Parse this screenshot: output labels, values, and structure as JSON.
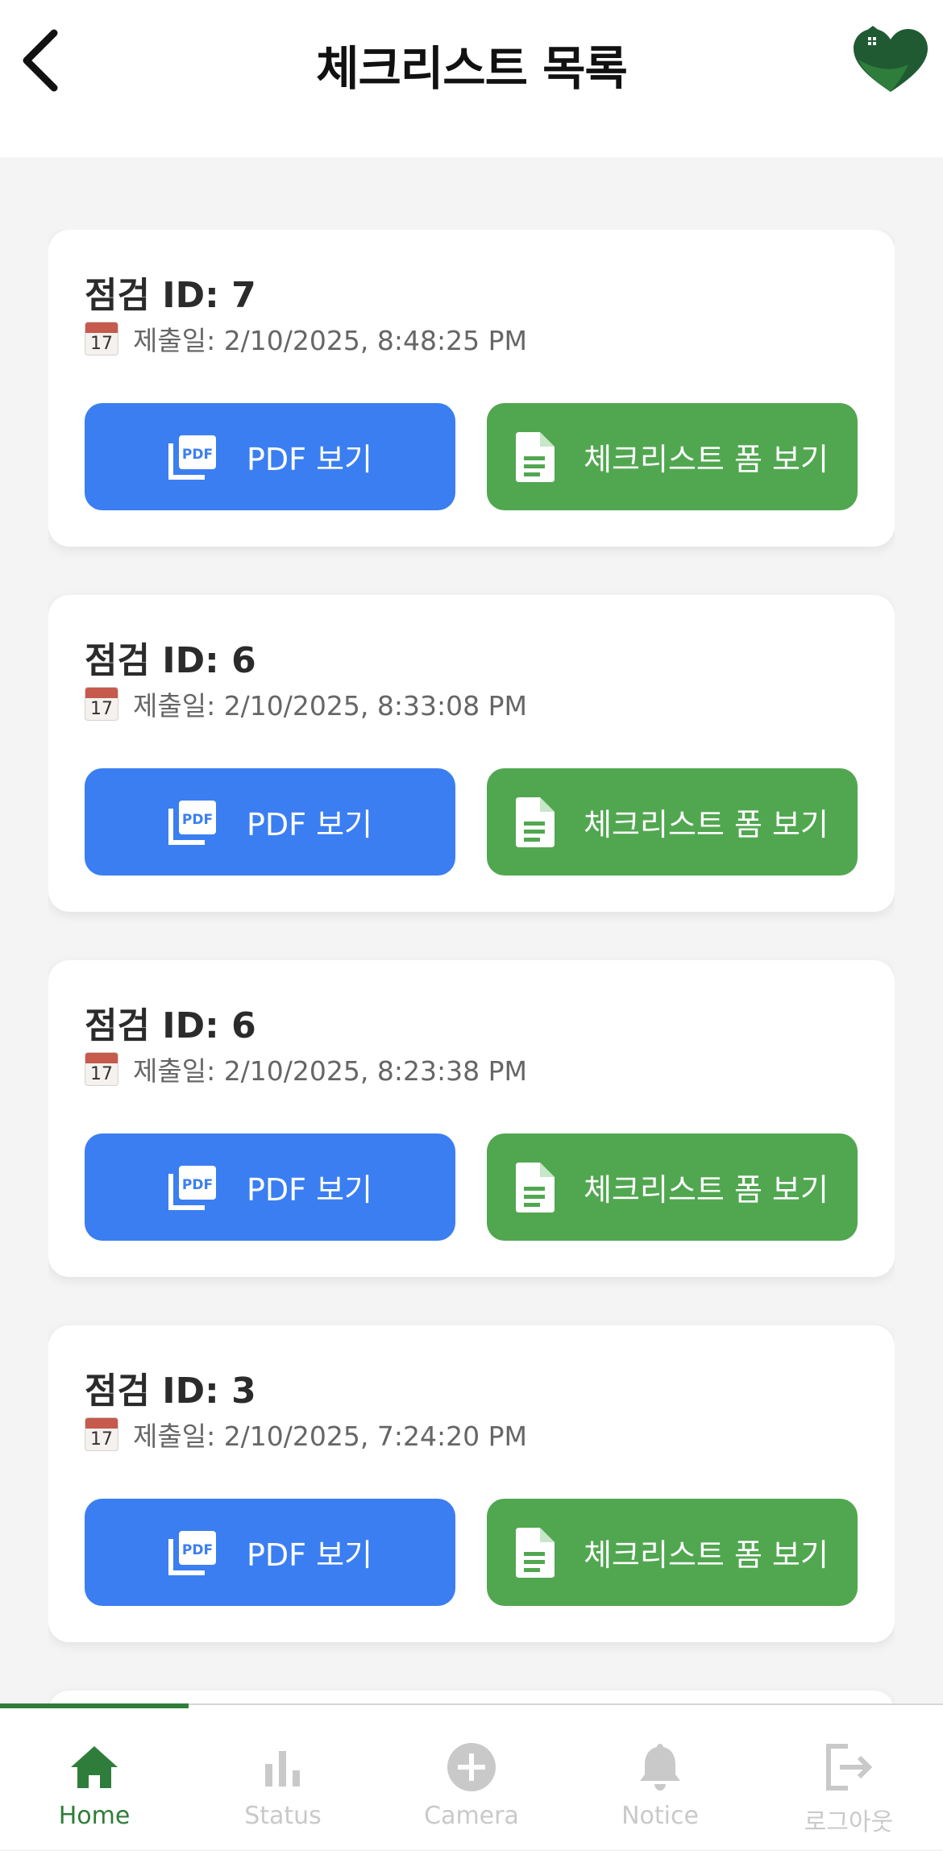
{
  "header": {
    "title": "체크리스트 목록",
    "back_icon": "chevron-left-icon",
    "logo_icon": "heart-house-logo"
  },
  "cards": [
    {
      "title": "점검 ID: 7",
      "date": "제출일: 2/10/2025, 8:48:25 PM",
      "calendar_day": "17",
      "pdf_label": "PDF 보기",
      "form_label": "체크리스트 폼 보기"
    },
    {
      "title": "점검 ID: 6",
      "date": "제출일: 2/10/2025, 8:33:08 PM",
      "calendar_day": "17",
      "pdf_label": "PDF 보기",
      "form_label": "체크리스트 폼 보기"
    },
    {
      "title": "점검 ID: 6",
      "date": "제출일: 2/10/2025, 8:23:38 PM",
      "calendar_day": "17",
      "pdf_label": "PDF 보기",
      "form_label": "체크리스트 폼 보기"
    },
    {
      "title": "점검 ID: 3",
      "date": "제출일: 2/10/2025, 7:24:20 PM",
      "calendar_day": "17",
      "pdf_label": "PDF 보기",
      "form_label": "체크리스트 폼 보기"
    }
  ],
  "tabs": [
    {
      "label": "Home",
      "icon": "home-icon",
      "active": true
    },
    {
      "label": "Status",
      "icon": "bar-chart-icon",
      "active": false
    },
    {
      "label": "Camera",
      "icon": "plus-circle-icon",
      "active": false
    },
    {
      "label": "Notice",
      "icon": "bell-icon",
      "active": false
    },
    {
      "label": "로그아웃",
      "icon": "logout-icon",
      "active": false
    }
  ],
  "colors": {
    "pdf_button": "#3b7ef1",
    "form_button": "#51a750",
    "active_tab": "#2f7d3a",
    "inactive_tab": "#c9c9c9"
  }
}
